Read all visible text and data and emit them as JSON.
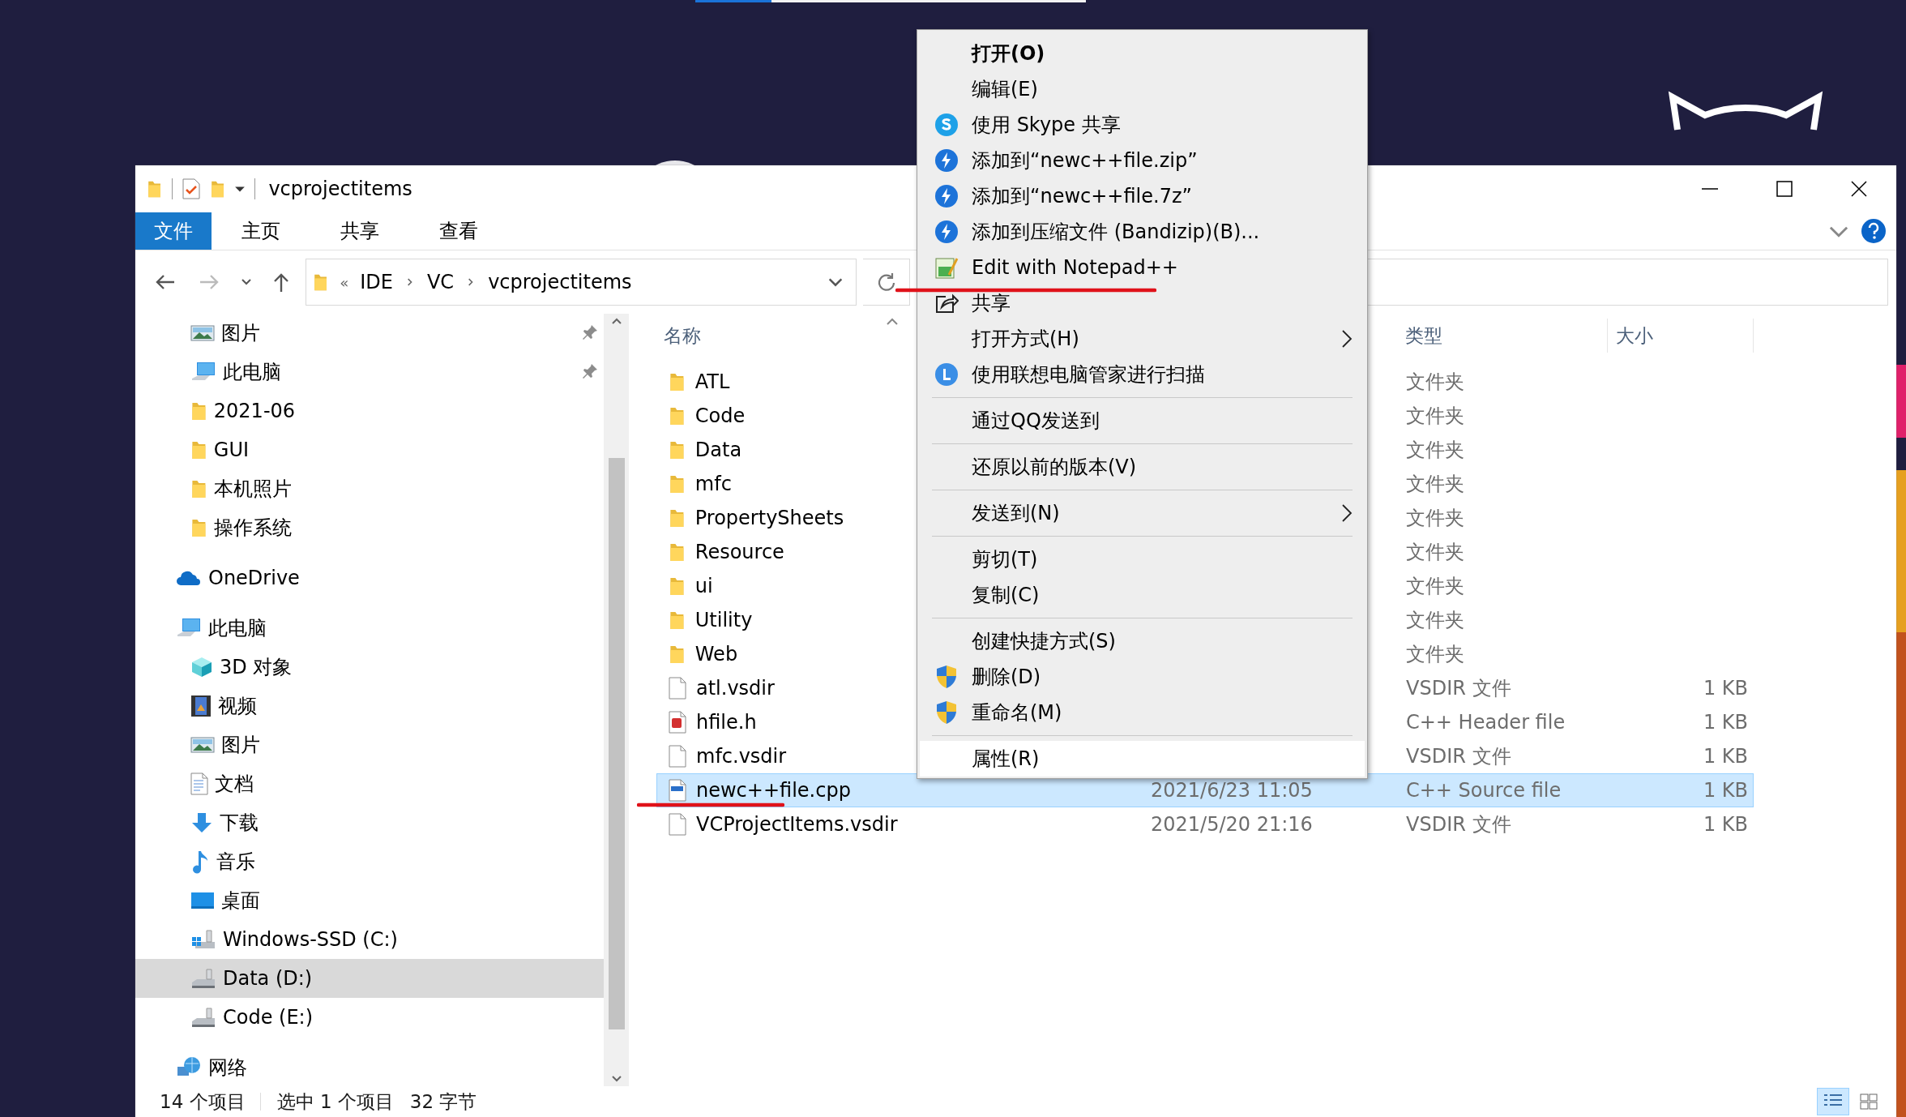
{
  "window": {
    "title": "vcprojectitems"
  },
  "ribbon": {
    "tabs": [
      {
        "label": "文件",
        "selected": true
      },
      {
        "label": "主页",
        "selected": false
      },
      {
        "label": "共享",
        "selected": false
      },
      {
        "label": "查看",
        "selected": false
      }
    ]
  },
  "address_bar": {
    "overflow": "«",
    "path": [
      "IDE",
      "VC",
      "vcprojectitems"
    ]
  },
  "navigation": {
    "quick_access": [
      {
        "label": "图片",
        "kind": "pictures",
        "pinned": true,
        "selected": false
      },
      {
        "label": "此电脑",
        "kind": "pc",
        "pinned": true,
        "selected": false
      },
      {
        "label": "2021-06",
        "kind": "folder",
        "pinned": false,
        "selected": false
      },
      {
        "label": "GUI",
        "kind": "folder",
        "pinned": false,
        "selected": false
      },
      {
        "label": "本机照片",
        "kind": "folder",
        "pinned": false,
        "selected": false
      },
      {
        "label": "操作系统",
        "kind": "folder",
        "pinned": false,
        "selected": false
      }
    ],
    "tree": [
      {
        "label": "OneDrive",
        "kind": "onedrive",
        "selected": false
      },
      {
        "label": "此电脑",
        "kind": "pc",
        "selected": false,
        "children": [
          {
            "label": "3D 对象",
            "kind": "objects3d",
            "selected": false
          },
          {
            "label": "视频",
            "kind": "video",
            "selected": false
          },
          {
            "label": "图片",
            "kind": "pictures",
            "selected": false
          },
          {
            "label": "文档",
            "kind": "documents",
            "selected": false
          },
          {
            "label": "下载",
            "kind": "downloads",
            "selected": false
          },
          {
            "label": "音乐",
            "kind": "music",
            "selected": false
          },
          {
            "label": "桌面",
            "kind": "desktop",
            "selected": false
          },
          {
            "label": "Windows-SSD (C:)",
            "kind": "windows_drive",
            "selected": false
          },
          {
            "label": "Data (D:)",
            "kind": "drive",
            "selected": true
          },
          {
            "label": "Code (E:)",
            "kind": "drive",
            "selected": false
          }
        ]
      },
      {
        "label": "网络",
        "kind": "network",
        "selected": false
      }
    ]
  },
  "file_list": {
    "columns": [
      {
        "label": "名称"
      },
      {
        "label": "类型"
      },
      {
        "label": "大小"
      }
    ],
    "rows": [
      {
        "name": "ATL",
        "kind": "folder",
        "type": "文件夹",
        "selected": false
      },
      {
        "name": "Code",
        "kind": "folder",
        "type": "文件夹",
        "selected": false
      },
      {
        "name": "Data",
        "kind": "folder",
        "type": "文件夹",
        "selected": false
      },
      {
        "name": "mfc",
        "kind": "folder",
        "type": "文件夹",
        "selected": false
      },
      {
        "name": "PropertySheets",
        "kind": "folder",
        "type": "文件夹",
        "selected": false
      },
      {
        "name": "Resource",
        "kind": "folder",
        "type": "文件夹",
        "selected": false
      },
      {
        "name": "ui",
        "kind": "folder",
        "type": "文件夹",
        "selected": false
      },
      {
        "name": "Utility",
        "kind": "folder",
        "type": "文件夹",
        "selected": false
      },
      {
        "name": "Web",
        "kind": "folder",
        "type": "文件夹",
        "selected": false
      },
      {
        "name": "atl.vsdir",
        "kind": "file",
        "type": "VSDIR 文件",
        "size": "1 KB",
        "selected": false
      },
      {
        "name": "hfile.h",
        "kind": "header",
        "type": "C++ Header file",
        "size": "1 KB",
        "selected": false
      },
      {
        "name": "mfc.vsdir",
        "kind": "file",
        "type": "VSDIR 文件",
        "size": "1 KB",
        "selected": false
      },
      {
        "name": "newc++file.cpp",
        "kind": "cpp",
        "date": "2021/6/23 11:05",
        "type": "C++ Source file",
        "size": "1 KB",
        "selected": true
      },
      {
        "name": "VCProjectItems.vsdir",
        "kind": "file",
        "date": "2021/5/20 21:16",
        "type": "VSDIR 文件",
        "size": "1 KB",
        "selected": false
      }
    ]
  },
  "status_bar": {
    "item_count": "14 个项目",
    "selection": "选中 1 个项目",
    "selection_size": "32 字节"
  },
  "context_menu": [
    {
      "kind": "item",
      "label": "打开(O)",
      "default": true,
      "highlighted": false
    },
    {
      "kind": "item",
      "label": "编辑(E)",
      "highlighted": false
    },
    {
      "kind": "skype",
      "label": "使用 Skype 共享",
      "highlighted": false
    },
    {
      "kind": "bandizip",
      "label": "添加到“newc++file.zip”",
      "highlighted": false
    },
    {
      "kind": "bandizip",
      "label": "添加到“newc++file.7z”",
      "highlighted": false
    },
    {
      "kind": "bandizip",
      "label": "添加到压缩文件 (Bandizip)(B)...",
      "highlighted": false
    },
    {
      "kind": "notepad",
      "label": "Edit with Notepad++",
      "highlighted": false
    },
    {
      "kind": "share",
      "label": "共享",
      "highlighted": false
    },
    {
      "kind": "item",
      "label": "打开方式(H)",
      "submenu": true,
      "highlighted": false
    },
    {
      "kind": "lenovo",
      "label": "使用联想电脑管家进行扫描",
      "highlighted": false
    },
    {
      "kind": "separator"
    },
    {
      "kind": "item",
      "label": "通过QQ发送到",
      "highlighted": false
    },
    {
      "kind": "separator"
    },
    {
      "kind": "item",
      "label": "还原以前的版本(V)",
      "highlighted": false
    },
    {
      "kind": "separator"
    },
    {
      "kind": "item",
      "label": "发送到(N)",
      "submenu": true,
      "highlighted": false
    },
    {
      "kind": "separator"
    },
    {
      "kind": "item",
      "label": "剪切(T)",
      "highlighted": false
    },
    {
      "kind": "item",
      "label": "复制(C)",
      "highlighted": false
    },
    {
      "kind": "separator"
    },
    {
      "kind": "item",
      "label": "创建快捷方式(S)",
      "highlighted": false
    },
    {
      "kind": "shield",
      "label": "删除(D)",
      "highlighted": false
    },
    {
      "kind": "shield",
      "label": "重命名(M)",
      "highlighted": false
    },
    {
      "kind": "separator"
    },
    {
      "kind": "item",
      "label": "属性(R)",
      "highlighted": true
    }
  ]
}
